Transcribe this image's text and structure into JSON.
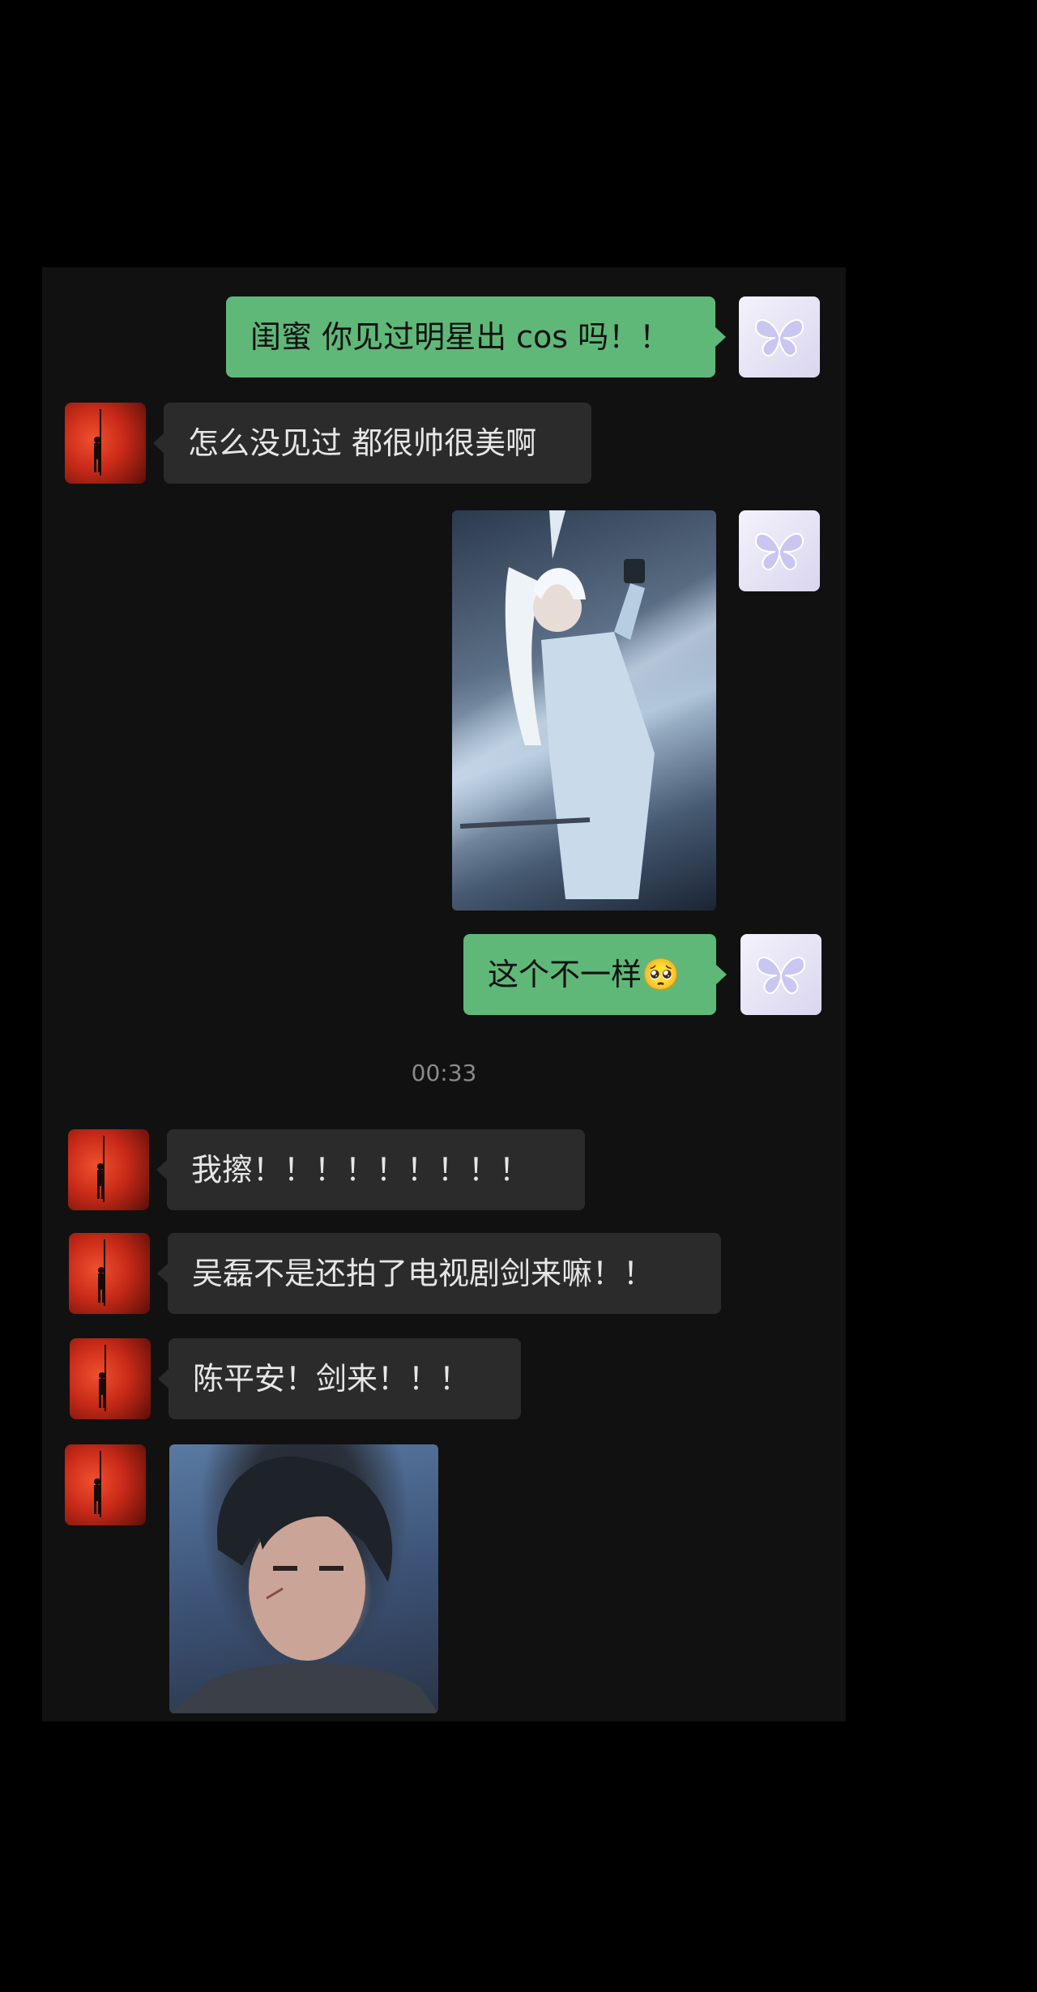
{
  "conversation": {
    "messages": [
      {
        "from": "me",
        "type": "text",
        "text": "闺蜜 你见过明星出 cos 吗！！"
      },
      {
        "from": "friend",
        "type": "text",
        "text": "怎么没见过 都很帅很美啊"
      },
      {
        "from": "me",
        "type": "image",
        "image_icon": "cosplay-photo"
      },
      {
        "from": "me",
        "type": "text",
        "text": "这个不一样🥺"
      },
      {
        "from": "friend",
        "type": "text",
        "text": "我擦！！！！！！！！！"
      },
      {
        "from": "friend",
        "type": "text",
        "text": "吴磊不是还拍了电视剧剑来嘛！！"
      },
      {
        "from": "friend",
        "type": "text",
        "text": "陈平安！剑来！！！"
      },
      {
        "from": "friend",
        "type": "image",
        "image_icon": "character-portrait"
      }
    ],
    "timestamp": "00:33"
  },
  "colors": {
    "outgoing_bubble": "#5fb878",
    "incoming_bubble": "#2b2b2b",
    "chat_background": "#111111",
    "page_background": "#000000"
  },
  "avatars": {
    "me_icon": "butterfly-icon",
    "friend_icon": "figure-on-red-icon"
  }
}
